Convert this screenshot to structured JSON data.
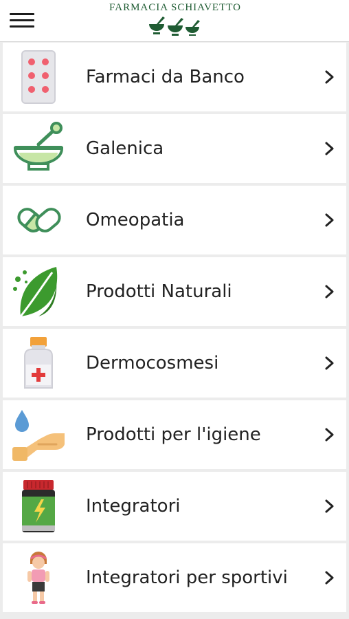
{
  "header": {
    "menu_icon": "hamburger-menu-icon",
    "logo_text": "FARMACIA SCHIAVETTO",
    "logo_icon": "mortar-and-pestle-logo",
    "brand_color": "#1f5c33"
  },
  "items": [
    {
      "label": "Farmaci da Banco",
      "icon": "pill-blister-icon"
    },
    {
      "label": "Galenica",
      "icon": "mortar-pestle-icon"
    },
    {
      "label": "Omeopatia",
      "icon": "capsules-icon"
    },
    {
      "label": "Prodotti Naturali",
      "icon": "leaf-icon"
    },
    {
      "label": "Dermocosmesi",
      "icon": "bottle-icon"
    },
    {
      "label": "Prodotti per l'igiene",
      "icon": "hand-drop-icon"
    },
    {
      "label": "Integratori",
      "icon": "supplement-jar-icon"
    },
    {
      "label": "Integratori per sportivi",
      "icon": "athlete-icon"
    }
  ],
  "chevron_icon": "chevron-right-icon"
}
